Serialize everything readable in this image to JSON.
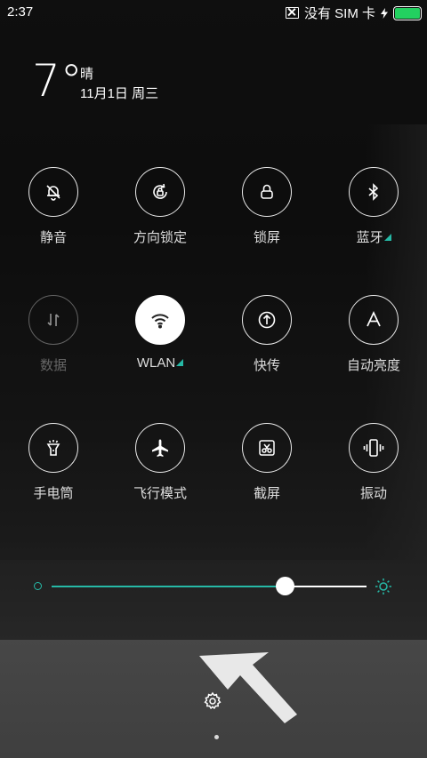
{
  "status_bar": {
    "time": "2:37",
    "carrier_text": "没有 SIM 卡",
    "battery_level": 1.0,
    "battery_color": "#23d160"
  },
  "weather": {
    "temperature": "7°",
    "condition": "晴",
    "date": "11月1日 周三"
  },
  "accent_color": "#26b9a6",
  "tiles": [
    {
      "label": "静音",
      "icon": "bell-off-icon",
      "state": "off"
    },
    {
      "label": "方向锁定",
      "icon": "rotation-lock-icon",
      "state": "off"
    },
    {
      "label": "锁屏",
      "icon": "lock-icon",
      "state": "off"
    },
    {
      "label": "蓝牙",
      "icon": "bluetooth-icon",
      "state": "off",
      "has_more": true
    },
    {
      "label": "数据",
      "icon": "data-arrows-icon",
      "state": "disabled"
    },
    {
      "label": "WLAN",
      "icon": "wifi-icon",
      "state": "on",
      "has_more": true
    },
    {
      "label": "快传",
      "icon": "transfer-icon",
      "state": "off"
    },
    {
      "label": "自动亮度",
      "icon": "auto-brightness-icon",
      "state": "off"
    },
    {
      "label": "手电筒",
      "icon": "flashlight-icon",
      "state": "off"
    },
    {
      "label": "飞行模式",
      "icon": "airplane-icon",
      "state": "off"
    },
    {
      "label": "截屏",
      "icon": "screenshot-icon",
      "state": "off"
    },
    {
      "label": "振动",
      "icon": "vibrate-icon",
      "state": "off"
    }
  ],
  "brightness": {
    "level": 0.74
  },
  "footer": {
    "settings_icon": "gear-icon",
    "page_indicator": 1
  }
}
